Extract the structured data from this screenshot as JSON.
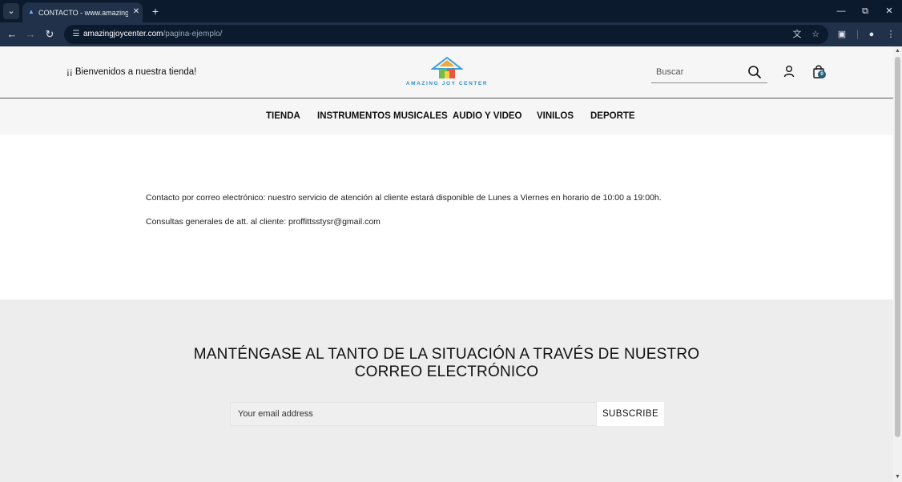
{
  "browser": {
    "tab": {
      "title": "CONTACTO - www.amazingjoycenter.com"
    },
    "address_bar": {
      "host": "amazingjoycenter.com",
      "path": "/pagina-ejemplo/"
    }
  },
  "header": {
    "welcome": "¡¡ Bienvenidos a nuestra tienda!",
    "logo_text": "AMAZING JOY CENTER",
    "search": {
      "placeholder": "Buscar"
    },
    "cart": {
      "count": "0"
    }
  },
  "nav": {
    "items": [
      {
        "label": "TIENDA"
      },
      {
        "label": "INSTRUMENTOS MUSICALES"
      },
      {
        "label": "AUDIO Y VIDEO"
      },
      {
        "label": "VINILOS"
      },
      {
        "label": "DEPORTE"
      }
    ]
  },
  "content": {
    "paragraphs": [
      "Contacto por correo electrónico: nuestro servicio de atención al cliente estará disponible de Lunes a Viernes en horario de 10:00 a 19:00h.",
      "Consultas generales de att. al cliente: proffittsstysr@gmail.com"
    ]
  },
  "newsletter": {
    "heading_line1": "MANTÉNGASE AL TANTO DE LA SITUACIÓN A TRAVÉS DE NUESTRO",
    "heading_line2": "CORREO ELECTRÓNICO",
    "email_placeholder": "Your email address",
    "button_label": "SUBSCRIBE"
  }
}
